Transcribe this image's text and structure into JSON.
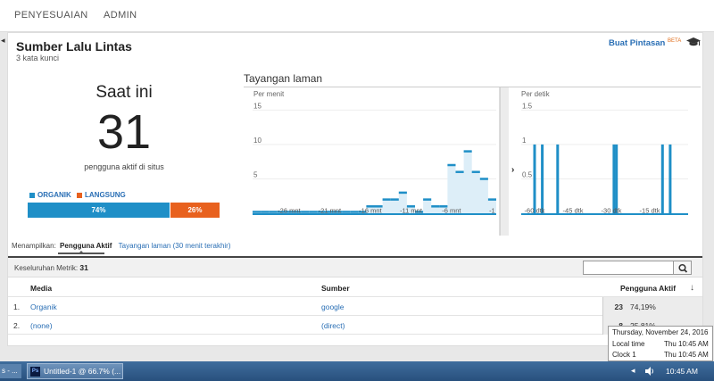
{
  "nav": {
    "tabs": [
      "PENYESUAIAN",
      "ADMIN"
    ]
  },
  "header": {
    "title": "Sumber Lalu Lintas",
    "subtitle": "3 kata kunci",
    "shortcut_label": "Buat Pintasan",
    "shortcut_badge": "BETA"
  },
  "summary": {
    "heading": "Saat ini",
    "count": "31",
    "label": "pengguna aktif di situs",
    "legend": [
      {
        "label": "ORGANIK",
        "color": "#1f8fc7"
      },
      {
        "label": "LANGSUNG",
        "color": "#e8611e"
      }
    ],
    "split": [
      {
        "label": "74%",
        "value": 0.74,
        "color": "#1f8fc7"
      },
      {
        "label": "26%",
        "value": 0.26,
        "color": "#e8611e"
      }
    ]
  },
  "pageviews": {
    "title": "Tayangan laman",
    "per_minute_label": "Per menit",
    "per_second_label": "Per detik",
    "divider_arrow": "›"
  },
  "chart_data": [
    {
      "type": "bar",
      "title": "Per menit",
      "ylim": [
        0,
        15
      ],
      "yticks": [
        "15",
        "10",
        "5"
      ],
      "x_tick_labels": [
        "-26 mnt",
        "-21 mnt",
        "-16 mnt",
        "-11 mnt",
        "-6 mnt",
        "-1"
      ],
      "x": [
        -30,
        -29,
        -28,
        -27,
        -26,
        -25,
        -24,
        -23,
        -22,
        -21,
        -20,
        -19,
        -18,
        -17,
        -16,
        -15,
        -14,
        -13,
        -12,
        -11,
        -10,
        -9,
        -8,
        -7,
        -6,
        -5,
        -4,
        -3,
        -2,
        -1
      ],
      "values": [
        0,
        0,
        0,
        0,
        0,
        0,
        0,
        0,
        0,
        0,
        0,
        0,
        0,
        0,
        1,
        1,
        2,
        2,
        3,
        1,
        0,
        2,
        1,
        1,
        7,
        6,
        9,
        6,
        5,
        2
      ]
    },
    {
      "type": "bar",
      "title": "Per detik",
      "ylim": [
        0,
        1.5
      ],
      "yticks": [
        "1.5",
        "1",
        "0.5"
      ],
      "x_tick_labels": [
        "-60 dtk",
        "-45 dtk",
        "-30 dtk",
        "-15 dtk"
      ],
      "x": [
        -60,
        -57,
        -51,
        -29,
        -28,
        -10,
        -7
      ],
      "values": [
        1,
        1,
        1,
        1,
        1,
        1,
        1
      ]
    }
  ],
  "showing": {
    "label": "Menampilkan:",
    "active_tab": "Pengguna Aktif",
    "other_tab": "Tayangan laman (30 menit terakhir)"
  },
  "metric": {
    "label": "Keseluruhan Metrik:",
    "value": "31"
  },
  "table": {
    "headers": [
      "Media",
      "Sumber",
      "Pengguna Aktif"
    ],
    "rows": [
      {
        "index": "1.",
        "media": "Organik",
        "source": "google",
        "count": "23",
        "pct": "74,19%"
      },
      {
        "index": "2.",
        "media": "(none)",
        "source": "(direct)",
        "count": "8",
        "pct": "25,81%"
      }
    ]
  },
  "tooltip": {
    "date": "Thursday, November 24, 2016",
    "local_label": "Local time",
    "local_value": "Thu 10:45 AM",
    "clock_label": "Clock 1",
    "clock_value": "Thu 10:45 AM"
  },
  "taskbar": {
    "stub_label": "s - ...",
    "app_label": "Untitled-1 @ 66.7% (...",
    "app_icon_text": "Ps",
    "time": "10:45 AM"
  },
  "icons": [
    "graduation-cap-icon",
    "search-icon",
    "sort-down-icon",
    "photoshop-icon",
    "speaker-icon",
    "tray-chevron-icon"
  ]
}
